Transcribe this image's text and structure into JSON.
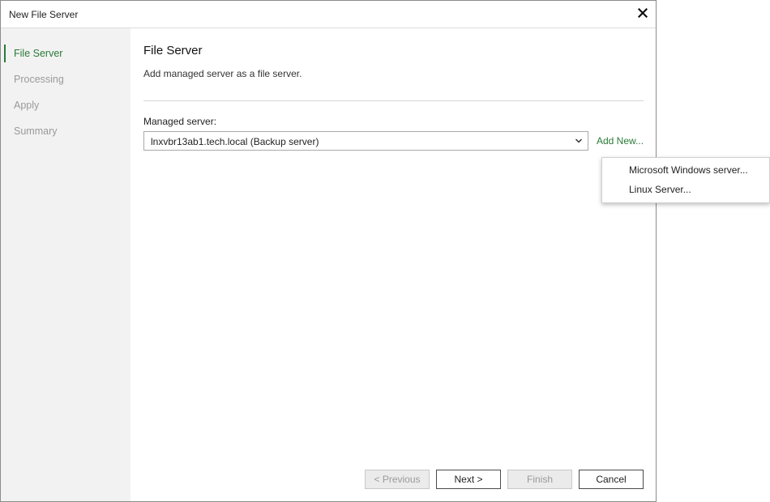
{
  "window": {
    "title": "New File Server",
    "close_icon": "close-icon"
  },
  "steps": [
    {
      "label": "File Server",
      "active": true
    },
    {
      "label": "Processing",
      "active": false
    },
    {
      "label": "Apply",
      "active": false
    },
    {
      "label": "Summary",
      "active": false
    }
  ],
  "page": {
    "title": "File Server",
    "subtitle": "Add managed server as a file server.",
    "managed_server_label": "Managed server:",
    "managed_server_value": "lnxvbr13ab1.tech.local (Backup server)",
    "add_new_label": "Add New..."
  },
  "add_new_menu": {
    "items": [
      "Microsoft Windows server...",
      "Linux Server..."
    ]
  },
  "buttons": {
    "previous": "< Previous",
    "next": "Next >",
    "finish": "Finish",
    "cancel": "Cancel"
  },
  "colors": {
    "accent": "#2b7a38",
    "sidebar_bg": "#f2f2f2",
    "disabled_text": "#9a9a9a"
  }
}
